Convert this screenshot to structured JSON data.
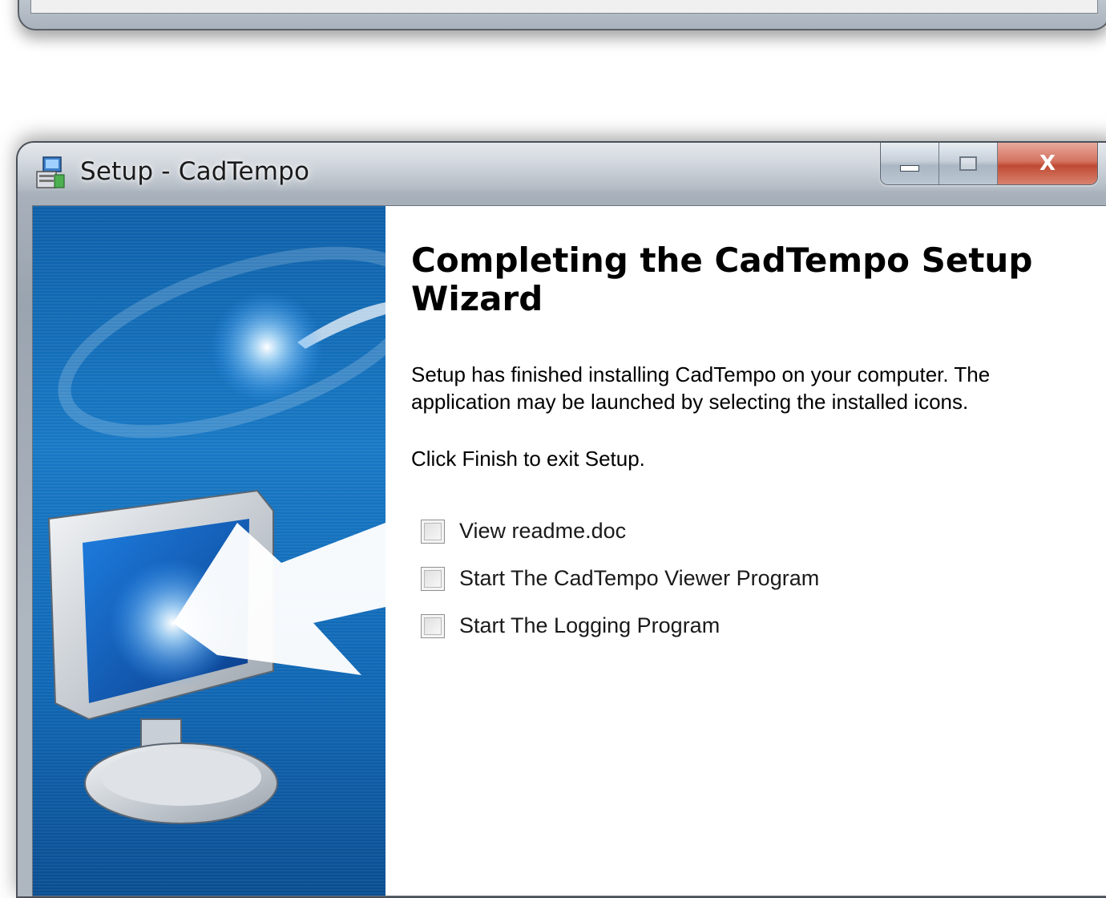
{
  "window": {
    "title": "Setup - CadTempo",
    "caption_buttons": {
      "close_glyph": "X"
    }
  },
  "wizard": {
    "heading": "Completing the CadTempo Setup Wizard",
    "body_text": "Setup has finished installing CadTempo on your computer. The application may be launched by selecting the installed icons.",
    "exit_text": "Click Finish to exit Setup.",
    "options": [
      {
        "label": "View readme.doc",
        "checked": false
      },
      {
        "label": "Start The CadTempo Viewer Program",
        "checked": false
      },
      {
        "label": "Start The Logging Program",
        "checked": false
      }
    ]
  },
  "icons": {
    "app": "setup-installer-icon",
    "sidebar": "computer-monitor-install-arrow-icon"
  },
  "colors": {
    "sidebar_blue": "#1778c4",
    "close_red": "#c04a33",
    "window_frame": "#a7b0ba"
  }
}
